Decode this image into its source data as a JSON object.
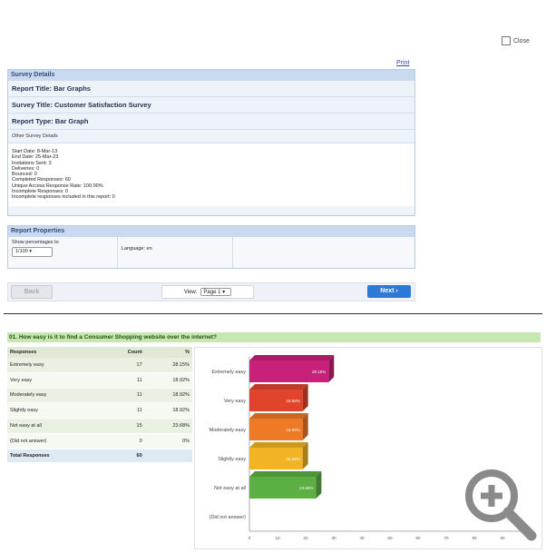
{
  "header": {
    "close_label": "Close",
    "print_label": "Print"
  },
  "survey_details": {
    "heading": "Survey Details",
    "report_title": "Report Title: Bar Graphs",
    "survey_title": "Survey Title: Customer Satisfaction Survey",
    "report_type": "Report Type: Bar Graph",
    "other_label": "Other Survey Details",
    "lines": [
      "Start Date: 8-Mar-13",
      "End Date: 25-Mar-23",
      "Invitations Sent: 3",
      "Deliveries: 0",
      "Bounced: 0",
      "Completed Responses: 60",
      "Unique Access Response Rate: 100.00%",
      "Incomplete Responses: 0",
      "Incomplete responses included in this report: 0"
    ]
  },
  "report_properties": {
    "heading": "Report Properties",
    "show_pct_label": "Show percentages to",
    "show_pct_value": "1/100",
    "language_label": "Language: en"
  },
  "nav": {
    "back_label": "Back",
    "view_label": "View:",
    "page_value": "Page 1",
    "next_label": "Next"
  },
  "question": {
    "title": "01. How easy is it to find a Consumer Shopping website over the internet?",
    "col_responses": "Responses",
    "col_count": "Count",
    "col_pct": "%",
    "rows": [
      {
        "label": "Extremely easy",
        "count": "17",
        "pct": "28.15%"
      },
      {
        "label": "Very easy",
        "count": "11",
        "pct": "18.92%"
      },
      {
        "label": "Moderately easy",
        "count": "11",
        "pct": "18.92%"
      },
      {
        "label": "Slightly easy",
        "count": "11",
        "pct": "18.92%"
      },
      {
        "label": "Not easy at all",
        "count": "15",
        "pct": "23.68%"
      },
      {
        "label": "(Did not answer)",
        "count": "0",
        "pct": "0%"
      }
    ],
    "total_label": "Total Responses",
    "total_count": "60"
  },
  "chart_data": {
    "type": "bar",
    "orientation": "horizontal",
    "categories": [
      "Extremely easy",
      "Very easy",
      "Moderately easy",
      "Slightly easy",
      "Not easy at all",
      "(Did not answer)"
    ],
    "values": [
      28.15,
      18.92,
      18.92,
      18.92,
      23.68,
      0
    ],
    "data_labels": [
      "28.15%",
      "18.92%",
      "18.92%",
      "18.92%",
      "23.68%",
      ""
    ],
    "colors": [
      "#c8217a",
      "#e0452b",
      "#ef7a26",
      "#f2b425",
      "#5cb043",
      "#cccccc"
    ],
    "xlim": [
      0,
      100
    ],
    "xticks": [
      "0",
      "10",
      "20",
      "30",
      "40",
      "50",
      "60",
      "70",
      "80",
      "90",
      "100"
    ],
    "grid": false,
    "legend": "none"
  }
}
